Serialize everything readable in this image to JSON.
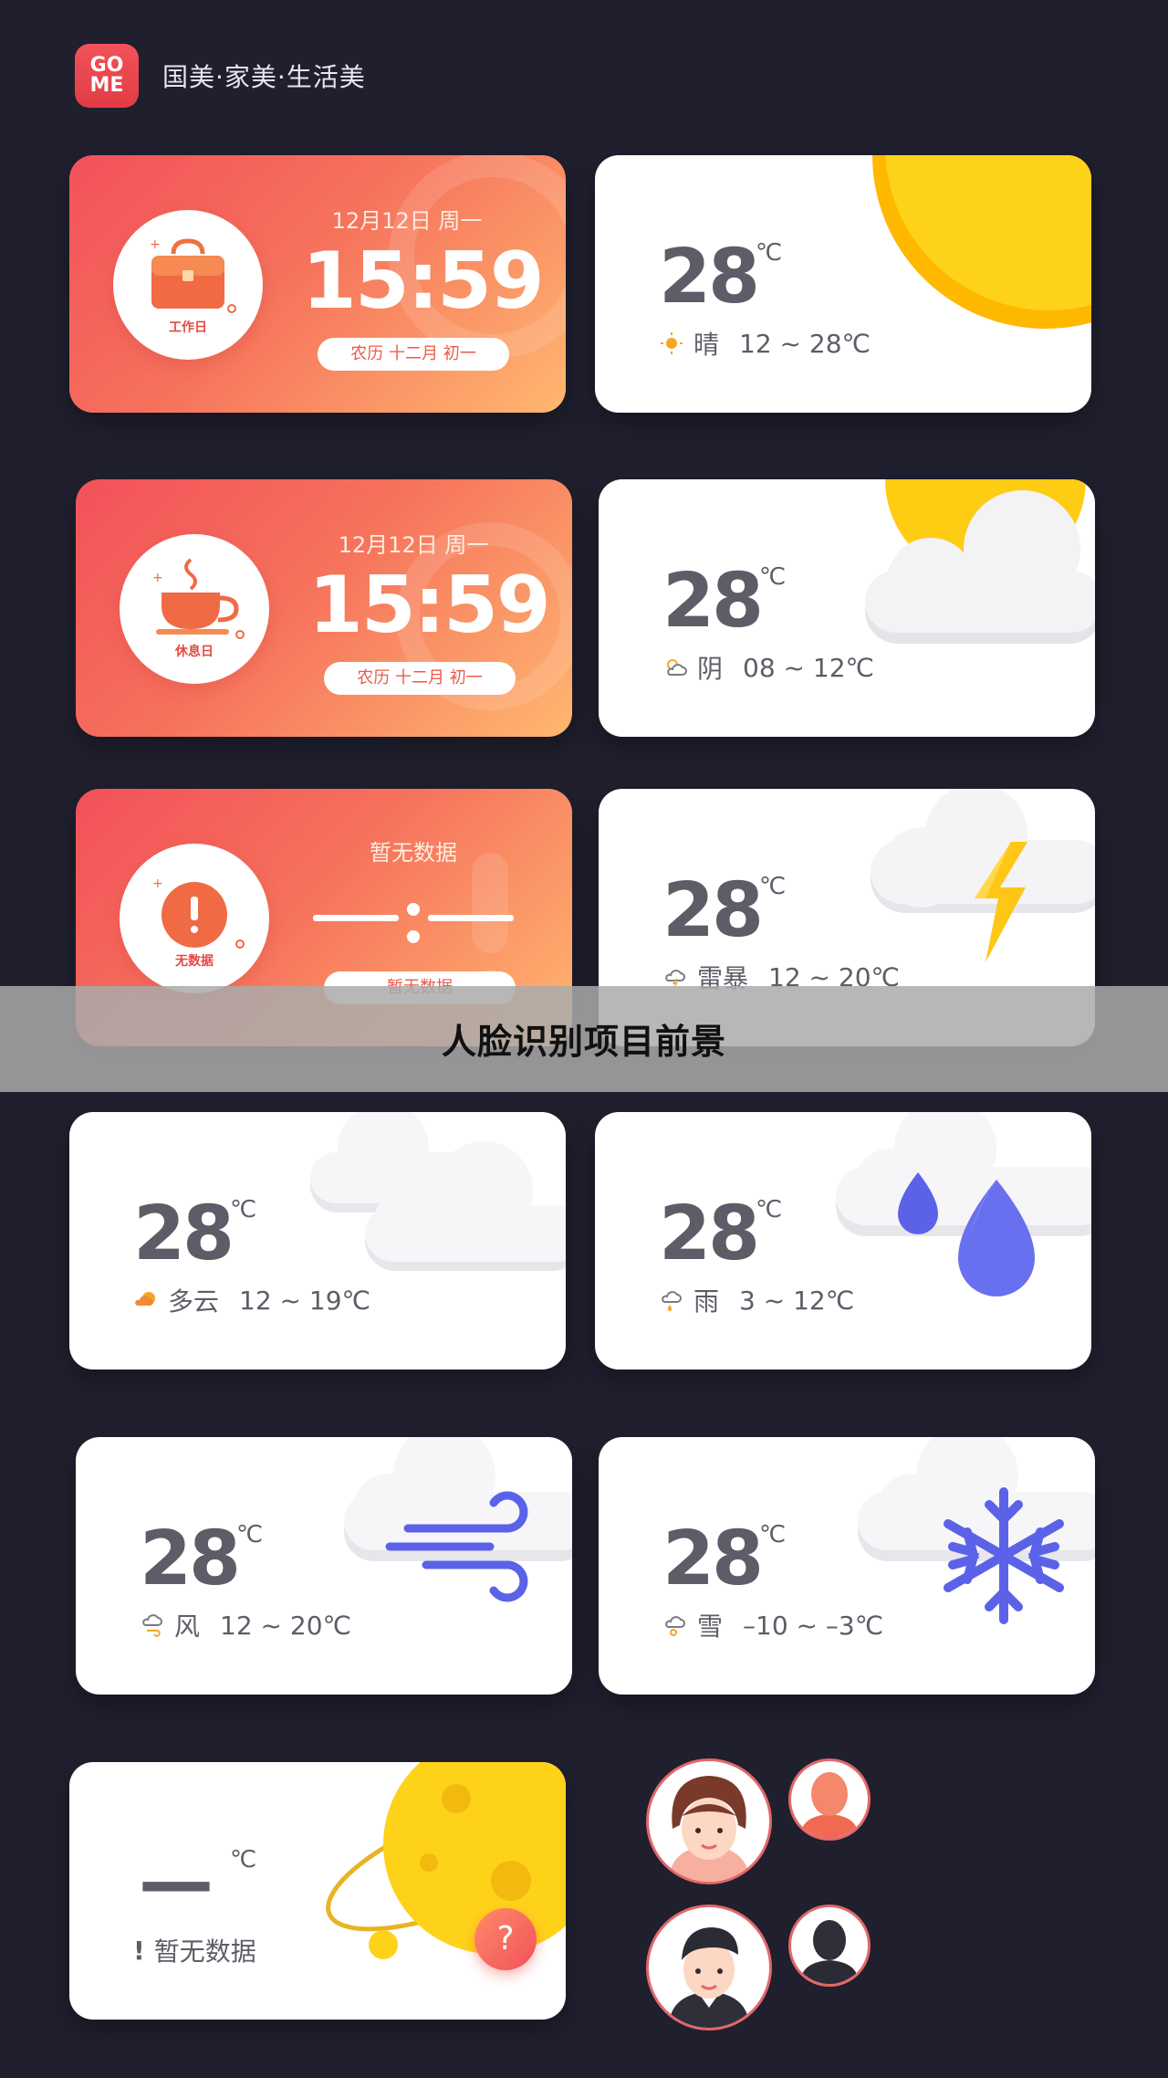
{
  "header": {
    "logo_top": "GO",
    "logo_bottom": "ME",
    "brand": "国美·家美·生活美"
  },
  "time_cards": [
    {
      "badge_label": "工作日",
      "date": "12月12日 周一",
      "time": "15:59",
      "lunar": "农历 十二月 初一"
    },
    {
      "badge_label": "休息日",
      "date": "12月12日 周一",
      "time": "15:59",
      "lunar": "农历 十二月 初一"
    },
    {
      "badge_label": "无数据",
      "date": "暂无数据",
      "time": "",
      "lunar": "暂无数据"
    }
  ],
  "weather_cards": [
    {
      "temp": "28",
      "unit": "℃",
      "condition": "晴",
      "range": "12 ~ 28℃",
      "icon": "sun-icon"
    },
    {
      "temp": "28",
      "unit": "℃",
      "condition": "阴",
      "range": "08 ~ 12℃",
      "icon": "cloudy-sun-icon"
    },
    {
      "temp": "28",
      "unit": "℃",
      "condition": "雷暴",
      "range": "12 ~ 20℃",
      "icon": "thunder-icon"
    },
    {
      "temp": "28",
      "unit": "℃",
      "condition": "多云",
      "range": "12 ~ 19℃",
      "icon": "clouds-icon"
    },
    {
      "temp": "28",
      "unit": "℃",
      "condition": "雨",
      "range": "3 ~ 12℃",
      "icon": "rain-icon"
    },
    {
      "temp": "28",
      "unit": "℃",
      "condition": "风",
      "range": "12 ~ 20℃",
      "icon": "wind-icon"
    },
    {
      "temp": "28",
      "unit": "℃",
      "condition": "雪",
      "range": "–10 ~ –3℃",
      "icon": "snow-icon"
    }
  ],
  "nodata_card": {
    "temp": "—",
    "unit": "℃",
    "message": "暂无数据",
    "mark": "!",
    "help": "?"
  },
  "overlay": {
    "text": "人脸识别项目前景"
  },
  "colors": {
    "bg": "#1f1f2e",
    "accent_orange": "#f2515a",
    "sun": "#ffcc14",
    "blue": "#5b62e8"
  }
}
